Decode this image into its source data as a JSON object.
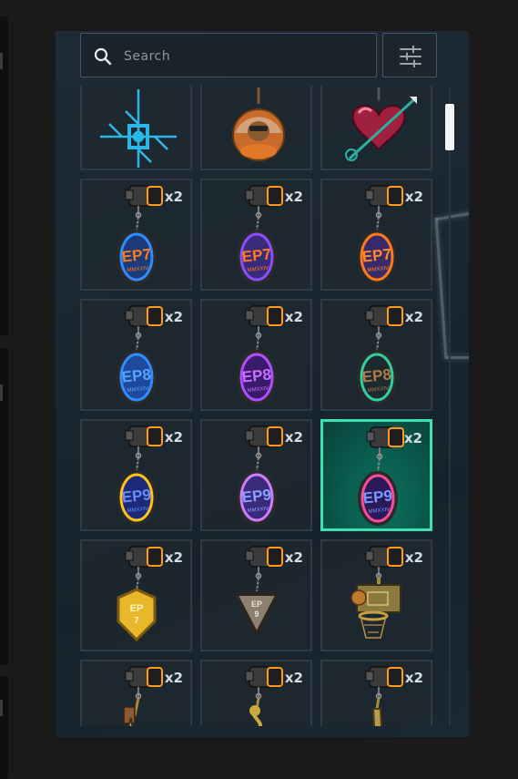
{
  "search": {
    "placeholder": "Search"
  },
  "inventory": {
    "items": [
      {
        "kind": "cross",
        "count": ""
      },
      {
        "kind": "orb",
        "count": ""
      },
      {
        "kind": "heart",
        "count": ""
      },
      {
        "kind": "disc",
        "label": "EP7",
        "sub": "MMXXIV",
        "ring": "#2f8cff",
        "face": "#1c3a7a",
        "text": "#ff7a1a",
        "count": "x2"
      },
      {
        "kind": "disc",
        "label": "EP7",
        "sub": "MMXXIV",
        "ring": "#8a4dff",
        "face": "#3a2a7a",
        "text": "#ff7a1a",
        "count": "x2"
      },
      {
        "kind": "disc",
        "label": "EP7",
        "sub": "MMXXIV",
        "ring": "#ff7a1a",
        "face": "#3a2a6a",
        "text": "#ff8c2a",
        "count": "x2"
      },
      {
        "kind": "disc",
        "label": "EP8",
        "sub": "MMXXIV",
        "ring": "#2f8cff",
        "face": "#1d4a9a",
        "text": "#5aa0ff",
        "count": "x2"
      },
      {
        "kind": "disc",
        "label": "EP8",
        "sub": "MMXXIV",
        "ring": "#b04dff",
        "face": "#3a1a6a",
        "text": "#c870ff",
        "count": "x2"
      },
      {
        "kind": "disc",
        "label": "EP8",
        "sub": "MMXXIV",
        "ring": "#2fd0a0",
        "face": "#1c2a30",
        "text": "#b07a4a",
        "count": "x2"
      },
      {
        "kind": "disc",
        "label": "EP9",
        "sub": "MMXXIV",
        "ring": "#ffc21a",
        "face": "#1c2a7a",
        "text": "#6a8aff",
        "count": "x2"
      },
      {
        "kind": "disc",
        "label": "EP9",
        "sub": "MMXXIV",
        "ring": "#d07aff",
        "face": "#3a2a7a",
        "text": "#8aa0ff",
        "count": "x2"
      },
      {
        "kind": "disc",
        "label": "EP9",
        "sub": "MMXXIV",
        "ring": "#ff4a9a",
        "face": "#2a1a5a",
        "text": "#7a9aff",
        "count": "x2",
        "selected": true
      },
      {
        "kind": "shield",
        "label": "EP",
        "sub": "7",
        "fill": "#e8b82a",
        "count": "x2"
      },
      {
        "kind": "triangle",
        "label": "EP",
        "sub": "9",
        "fill": "#8c8070",
        "count": "x2"
      },
      {
        "kind": "hoop",
        "count": "x2"
      },
      {
        "kind": "pole",
        "count": "x2"
      },
      {
        "kind": "figure",
        "count": "x2"
      },
      {
        "kind": "bottle",
        "count": "x2"
      }
    ]
  },
  "colors": {
    "accent": "#3de0b0",
    "panel": "#1b2731"
  }
}
